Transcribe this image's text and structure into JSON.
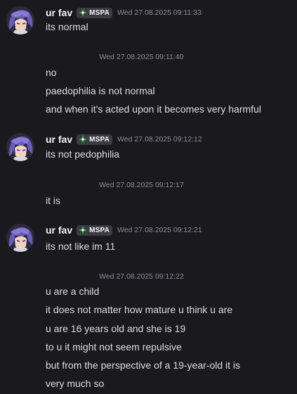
{
  "user": {
    "name": "ur fav",
    "tag": "MSPA"
  },
  "messages": [
    {
      "timestamp": "Wed 27.08.2025 09:11:33",
      "lines": [
        "its normal"
      ]
    },
    {
      "timestamp": "Wed 27.08.2025 09:11:40",
      "lines": [
        "no",
        "paedophilia is not normal",
        "and when it's acted upon it becomes very harmful"
      ]
    },
    {
      "timestamp": "Wed 27.08.2025 09:12:12",
      "lines": [
        "its not pedophilia"
      ]
    },
    {
      "timestamp": "Wed 27.08.2025 09:12:17",
      "lines": [
        "it is"
      ]
    },
    {
      "timestamp": "Wed 27.08.2025 09:12:21",
      "lines": [
        "its not like im 11"
      ]
    },
    {
      "timestamp": "Wed 27.08.2025 09:12:22",
      "lines": [
        "u are a child",
        "it does not matter how mature u think u are",
        "u are 16 years old and she is 19",
        "to u it might not seem repulsive",
        "but from the perspective of a 19-year-old it is",
        "very much so"
      ]
    }
  ]
}
